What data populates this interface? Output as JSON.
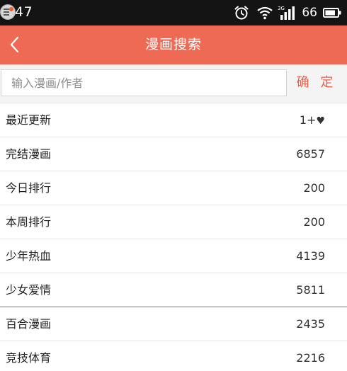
{
  "status_bar": {
    "time": "47",
    "battery_level": "66",
    "network_label": "3G"
  },
  "header": {
    "title": "漫画搜索",
    "back_label": "返回",
    "background_color": "#ef6a55"
  },
  "search": {
    "placeholder": "输入漫画/作者",
    "value": "",
    "confirm_label": "确 定",
    "confirm_color": "#e3634c"
  },
  "categories": [
    {
      "label": "最近更新",
      "count": "1+"
    },
    {
      "label": "完结漫画",
      "count": "6857"
    },
    {
      "label": "今日排行",
      "count": "200"
    },
    {
      "label": "本周排行",
      "count": "200"
    },
    {
      "label": "少年热血",
      "count": "4139"
    },
    {
      "label": "少女爱情",
      "count": "5811"
    },
    {
      "label": "百合漫画",
      "count": "2435"
    },
    {
      "label": "竞技体育",
      "count": "2216"
    }
  ],
  "icons": {
    "heart": "heart-icon",
    "alarm": "alarm-icon",
    "wifi": "wifi-icon",
    "signal": "signal-icon",
    "battery": "battery-icon",
    "back": "chevron-left-icon"
  }
}
